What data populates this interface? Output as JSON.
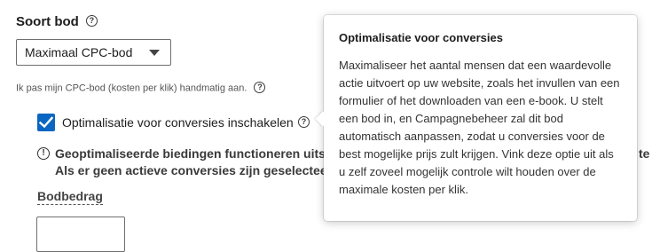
{
  "section": {
    "title": "Soort bod",
    "select_value": "Maximaal CPC-bod",
    "note": "Ik pas mijn CPC-bod (kosten per klik) handmatig aan."
  },
  "conversion_checkbox": {
    "label": "Optimalisatie voor conversies inschakelen",
    "checked": true,
    "accent_color": "#0a66c2"
  },
  "warning": {
    "line1": "Geoptimaliseerde biedingen functioneren uitslu",
    "line1_tail": "te",
    "line2": "Als er geen actieve conversies zijn geselecteerd,"
  },
  "bid_amount": {
    "label": "Bodbedrag",
    "value": ""
  },
  "tooltip": {
    "title": "Optimalisatie voor conversies",
    "body": "Maximaliseer het aantal mensen dat een waardevolle actie uitvoert op uw website, zoals het invullen van een formulier of het downloaden van een e-book. U stelt een bod in, en Campagnebeheer zal dit bod automatisch aanpassen, zodat u conversies voor de best mogelijke prijs zult krijgen. Vink deze optie uit als u zelf zoveel mogelijk controle wilt houden over de maximale kosten per klik."
  },
  "icons": {
    "help": "?",
    "info": "!"
  }
}
